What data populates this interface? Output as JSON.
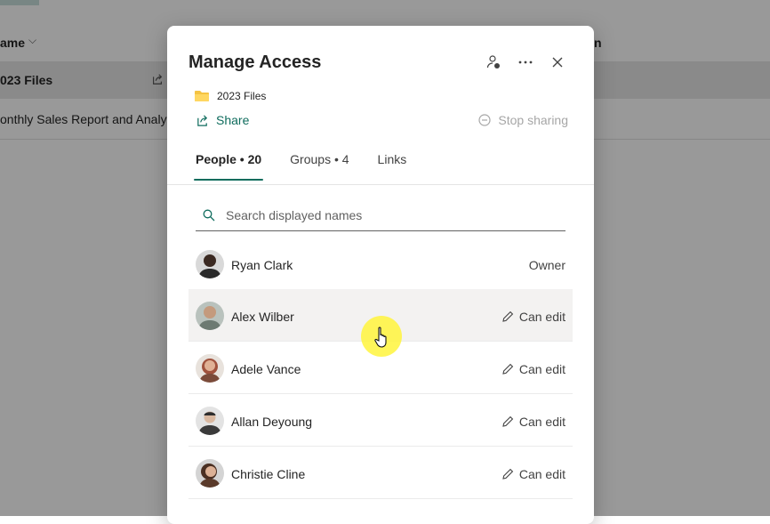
{
  "background": {
    "column_name": "ame",
    "column_right": "n",
    "rows": [
      "023 Files",
      "onthly Sales Report and Analys"
    ]
  },
  "dialog": {
    "title": "Manage Access",
    "folder_name": "2023 Files",
    "share_label": "Share",
    "stop_sharing_label": "Stop sharing",
    "tabs": [
      {
        "label": "People • 20",
        "active": true
      },
      {
        "label": "Groups • 4",
        "active": false
      },
      {
        "label": "Links",
        "active": false
      }
    ],
    "search_placeholder": "Search displayed names",
    "people": [
      {
        "name": "Ryan Clark",
        "permission": "Owner",
        "avatar_color": "#3b2a22"
      },
      {
        "name": "Alex Wilber",
        "permission": "Can edit",
        "avatar_color": "#7a8a80"
      },
      {
        "name": "Adele Vance",
        "permission": "Can edit",
        "avatar_color": "#a0523d"
      },
      {
        "name": "Allan Deyoung",
        "permission": "Can edit",
        "avatar_color": "#4a4a4a"
      },
      {
        "name": "Christie Cline",
        "permission": "Can edit",
        "avatar_color": "#5a3a2a"
      }
    ]
  },
  "colors": {
    "accent": "#0f6c5d",
    "cursor_highlight": "#fff53c"
  }
}
